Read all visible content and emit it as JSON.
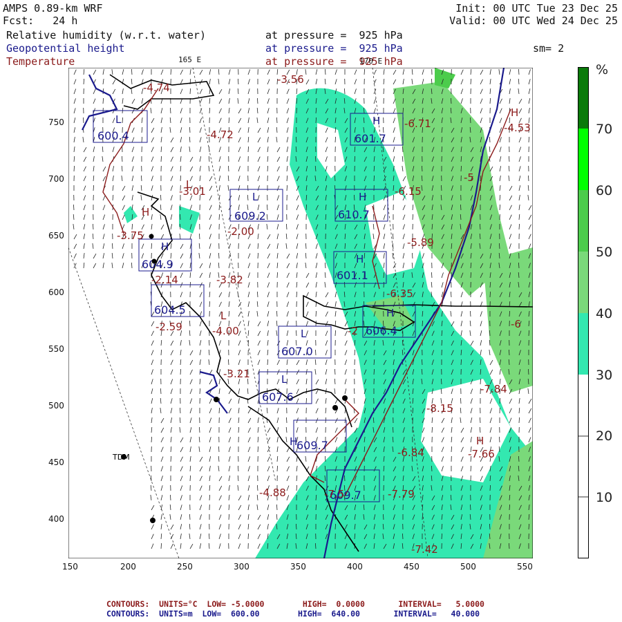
{
  "header": {
    "model": "AMPS 0.89-km WRF",
    "fcst_label": "Fcst:",
    "fcst_value": "24 h",
    "init": "Init: 00 UTC Tue 23 Dec 25",
    "valid": "Valid: 00 UTC Wed 24 Dec 25",
    "field1": "Relative humidity (w.r.t. water)",
    "field2": "Geopotential height",
    "field3": "Temperature",
    "pressure1": "at pressure =  925 hPa",
    "pressure2": "at pressure =  925 hPa",
    "pressure3": "at pressure =  925 hPa",
    "smoothing": "sm= 2",
    "lon_165": "165 E",
    "lon_170": "170 E"
  },
  "colorbar": {
    "unit": "%",
    "labels": [
      "70",
      "60",
      "50",
      "40",
      "30",
      "20",
      "10"
    ],
    "colors": [
      "#ffffff",
      "#ffffff",
      "#ffffff",
      "#33e8b0",
      "#7ad97a",
      "#4ccc4c",
      "#00ff00",
      "#0a7a0a"
    ]
  },
  "axes": {
    "x_ticks": [
      "150",
      "200",
      "250",
      "300",
      "350",
      "400",
      "450",
      "500",
      "550"
    ],
    "y_ticks": [
      "750",
      "700",
      "650",
      "600",
      "550",
      "500",
      "450",
      "400"
    ]
  },
  "station": "TDM",
  "height_labels": [
    "600.4",
    "609.2",
    "601.7",
    "610.7",
    "604.9",
    "601.1",
    "604.5",
    "606.4",
    "607.0",
    "607.6",
    "609.7",
    "609.7"
  ],
  "temperature_labels": [
    "-4.74",
    "-3.56",
    "-4.72",
    "-6.71",
    "-4.53",
    "-3.01",
    "-3.75",
    "-2.00",
    "-6.15",
    "-5",
    "-5.89",
    "-2.14",
    "-3.82",
    "-6.35",
    "-2.59",
    "-4.00",
    "-6",
    "-7.84",
    "-2",
    "-8.15",
    "-7.66",
    "-6.84",
    "-4.88",
    "-7.79",
    "-7.42",
    "-3.21",
    "-7.5"
  ],
  "letters": {
    "low": "L",
    "high": "H"
  },
  "footer": {
    "line1_label": "CONTOURS:  UNITS=°C  LOW= -5.0000",
    "line1_high": "HIGH=  0.0000",
    "line1_int": "INTERVAL=   5.0000",
    "line2_label": "CONTOURS:  UNITS=m  LOW=  600.00",
    "line2_high": "HIGH=  640.00",
    "line2_int": "INTERVAL=   40.000"
  }
}
